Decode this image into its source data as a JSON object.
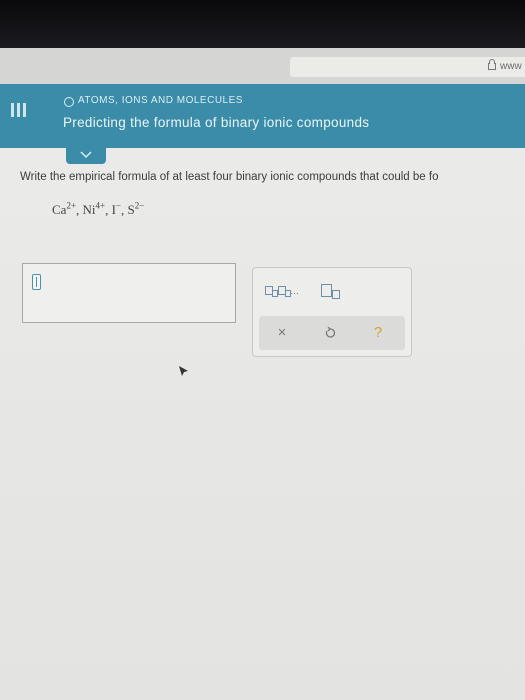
{
  "browser": {
    "url_text": "www"
  },
  "header": {
    "topic": "ATOMS, IONS AND MOLECULES",
    "title": "Predicting the formula of binary ionic compounds"
  },
  "question": {
    "prompt": "Write the empirical formula of at least four binary ionic compounds that could be fo",
    "ions": [
      {
        "symbol": "Ca",
        "charge": "2+"
      },
      {
        "symbol": "Ni",
        "charge": "4+"
      },
      {
        "symbol": "I",
        "charge": "−"
      },
      {
        "symbol": "S",
        "charge": "2−"
      }
    ]
  },
  "palette": {
    "close_glyph": "×",
    "help_glyph": "?"
  },
  "icons": [
    "menu-icon",
    "lock-icon",
    "chevron-down-icon",
    "text-cursor-icon",
    "undo-icon",
    "pointer-icon"
  ],
  "colors": {
    "header": "#3a8ca9",
    "help": "#d7a137"
  }
}
